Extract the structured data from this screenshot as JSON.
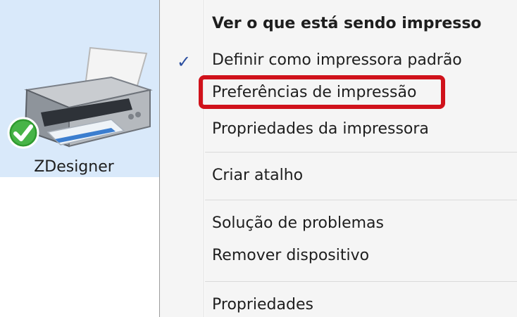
{
  "device": {
    "label": "ZDesigner",
    "icon": "printer-icon",
    "status_icon": "default-check-icon"
  },
  "context_menu": {
    "items": [
      {
        "label": "Ver o que está sendo impresso",
        "bold": true
      },
      {
        "label": "Definir como impressora padrão",
        "checked": true
      },
      {
        "label": "Preferências de impressão",
        "highlighted": true
      },
      {
        "label": "Propriedades da impressora"
      },
      {
        "label": "Criar atalho"
      },
      {
        "label": "Solução de problemas"
      },
      {
        "label": "Remover dispositivo"
      },
      {
        "label": "Propriedades"
      }
    ],
    "check_glyph": "✓",
    "highlight_color": "#d0121b"
  }
}
